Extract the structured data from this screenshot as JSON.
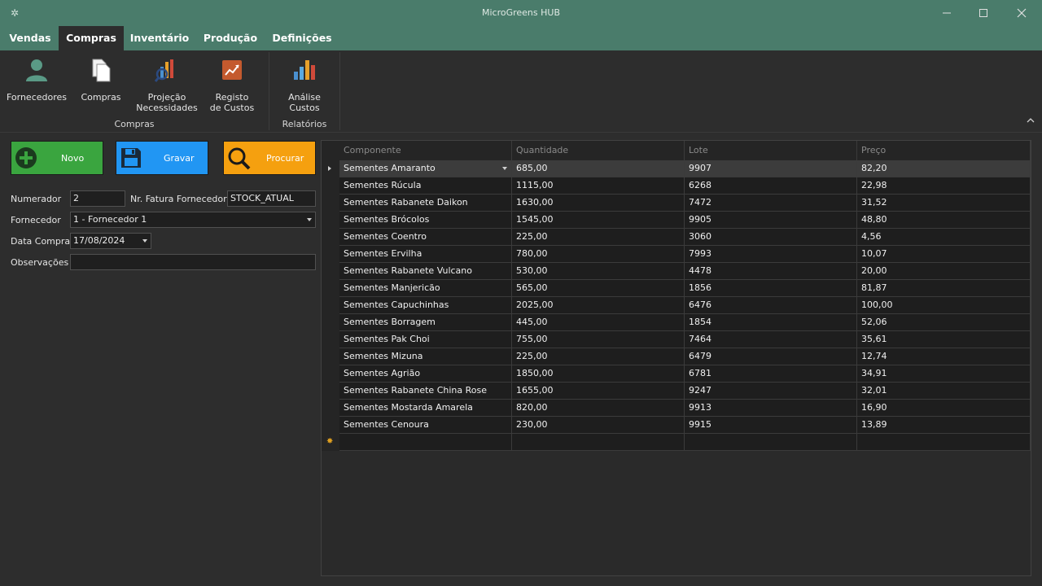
{
  "window": {
    "title": "MicroGreens HUB"
  },
  "menu": {
    "tabs": [
      "Vendas",
      "Compras",
      "Inventário",
      "Produção",
      "Definições"
    ],
    "active": "Compras"
  },
  "ribbon": {
    "buttons": [
      {
        "label_1": "Fornecedores",
        "label_2": "",
        "icon": "person-icon"
      },
      {
        "label_1": "Compras",
        "label_2": "",
        "icon": "documents-icon"
      },
      {
        "label_1": "Projeção",
        "label_2": "Necessidades",
        "icon": "chart-magnifier-icon"
      },
      {
        "label_1": "Registo",
        "label_2": "de Custos",
        "icon": "trend-chart-icon"
      },
      {
        "label_1": "Análise",
        "label_2": "Custos",
        "icon": "bar-chart-icon"
      }
    ],
    "groups": [
      "Compras",
      "Relatórios"
    ]
  },
  "actions": {
    "novo": "Novo",
    "gravar": "Gravar",
    "procurar": "Procurar",
    "colors": {
      "novo": "#3aa53f",
      "gravar": "#2196f3",
      "procurar": "#f5a00f"
    }
  },
  "form": {
    "numerador_label": "Numerador",
    "numerador_value": "2",
    "fatura_label": "Nr. Fatura Fornecedor",
    "fatura_value": "STOCK_ATUAL",
    "fornecedor_label": "Fornecedor",
    "fornecedor_value": "1 - Fornecedor 1",
    "data_label": "Data Compra",
    "data_value": "17/08/2024",
    "obs_label": "Observações",
    "obs_value": ""
  },
  "grid": {
    "columns": [
      "Componente",
      "Quantidade",
      "Lote",
      "Preço"
    ],
    "rows": [
      [
        "Sementes Amaranto",
        "685,00",
        "9907",
        "82,20"
      ],
      [
        "Sementes Rúcula",
        "1115,00",
        "6268",
        "22,98"
      ],
      [
        "Sementes Rabanete Daikon",
        "1630,00",
        "7472",
        "31,52"
      ],
      [
        "Sementes Brócolos",
        "1545,00",
        "9905",
        "48,80"
      ],
      [
        "Sementes Coentro",
        "225,00",
        "3060",
        "4,56"
      ],
      [
        "Sementes Ervilha",
        "780,00",
        "7993",
        "10,07"
      ],
      [
        "Sementes Rabanete Vulcano",
        "530,00",
        "4478",
        "20,00"
      ],
      [
        "Sementes Manjericão",
        "565,00",
        "1856",
        "81,87"
      ],
      [
        "Sementes Capuchinhas",
        "2025,00",
        "6476",
        "100,00"
      ],
      [
        "Sementes Borragem",
        "445,00",
        "1854",
        "52,06"
      ],
      [
        "Sementes Pak Choi",
        "755,00",
        "7464",
        "35,61"
      ],
      [
        "Sementes Mizuna",
        "225,00",
        "6479",
        "12,74"
      ],
      [
        "Sementes Agrião",
        "1850,00",
        "6781",
        "34,91"
      ],
      [
        "Sementes Rabanete China Rose",
        "1655,00",
        "9247",
        "32,01"
      ],
      [
        "Sementes Mostarda Amarela",
        "820,00",
        "9913",
        "16,90"
      ],
      [
        "Sementes Cenoura",
        "230,00",
        "9915",
        "13,89"
      ]
    ]
  }
}
